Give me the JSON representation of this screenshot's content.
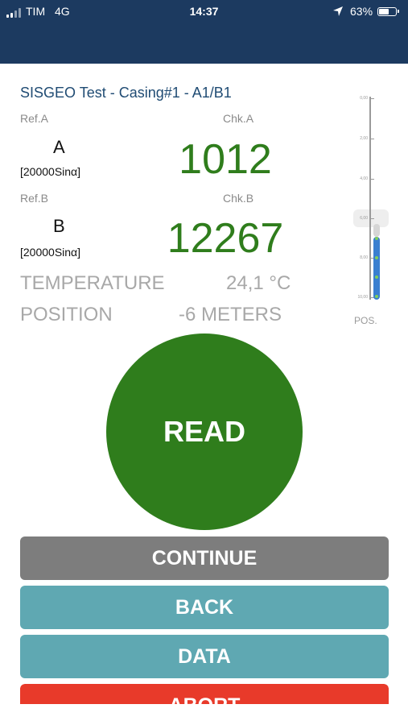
{
  "status": {
    "carrier": "TIM",
    "network": "4G",
    "time": "14:37",
    "battery": "63%"
  },
  "title": "SISGEO Test - Casing#1 - A1/B1",
  "ref_a": {
    "label": "Ref.A",
    "letter": "A",
    "unit": "[20000Sinα]"
  },
  "chk_a": {
    "label": "Chk.A",
    "value": "1012"
  },
  "ref_b": {
    "label": "Ref.B",
    "letter": "B",
    "unit": "[20000Sinα]"
  },
  "chk_b": {
    "label": "Chk.B",
    "value": "12267"
  },
  "temperature": {
    "label": "TEMPERATURE",
    "value": "24,1 °C"
  },
  "position": {
    "label": "POSITION",
    "value": "-6 METERS"
  },
  "gauge": {
    "tick_labels": [
      "0,00",
      "2,00",
      "4,00",
      "6,00",
      "8,00",
      "10,00"
    ],
    "label": "POS."
  },
  "buttons": {
    "read": "READ",
    "continue": "CONTINUE",
    "back": "BACK",
    "data": "DATA",
    "abort": "ABORT"
  },
  "colors": {
    "header": "#1c3a60",
    "reading_green": "#2f7d1c",
    "continue_grey": "#7d7d7d",
    "teal": "#5fa8b2",
    "abort_red": "#e83a2a"
  }
}
